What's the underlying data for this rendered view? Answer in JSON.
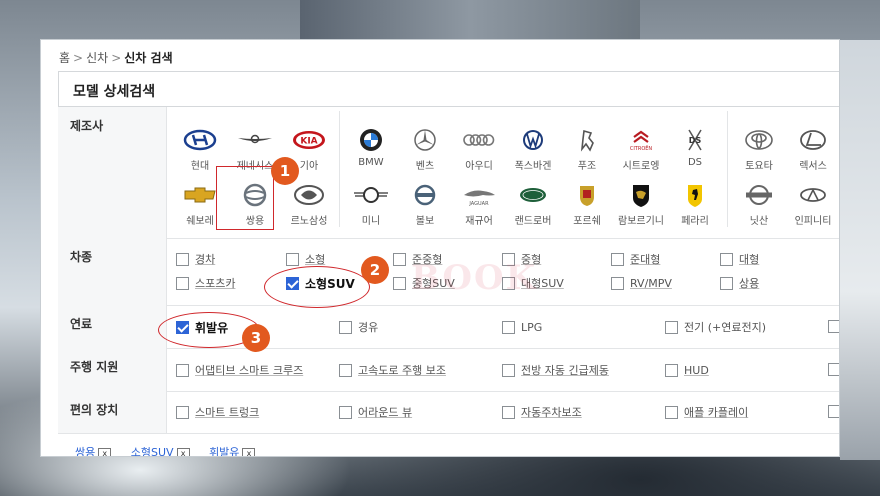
{
  "breadcrumb": {
    "home": "홈",
    "sep": ">",
    "level1": "신차",
    "current": "신차 검색"
  },
  "section_title": "모델 상세검색",
  "watermark": "BOOK",
  "manufacturer": {
    "label": "제조사",
    "domestic": [
      {
        "name": "현대",
        "icon": "hyundai-logo"
      },
      {
        "name": "제네시스",
        "icon": "genesis-logo"
      },
      {
        "name": "기아",
        "icon": "kia-logo"
      },
      {
        "name": "쉐보레",
        "icon": "chevrolet-logo"
      },
      {
        "name": "쌍용",
        "icon": "ssangyong-logo"
      },
      {
        "name": "르노삼성",
        "icon": "renault-samsung-logo"
      }
    ],
    "europe": [
      {
        "name": "BMW",
        "icon": "bmw-logo"
      },
      {
        "name": "벤츠",
        "icon": "benz-logo"
      },
      {
        "name": "아우디",
        "icon": "audi-logo"
      },
      {
        "name": "폭스바겐",
        "icon": "volkswagen-logo"
      },
      {
        "name": "푸조",
        "icon": "peugeot-logo"
      },
      {
        "name": "시트로엥",
        "icon": "citroen-logo"
      },
      {
        "name": "DS",
        "icon": "ds-logo"
      },
      {
        "name": "미니",
        "icon": "mini-logo"
      },
      {
        "name": "볼보",
        "icon": "volvo-logo"
      },
      {
        "name": "재규어",
        "icon": "jaguar-logo"
      },
      {
        "name": "랜드로버",
        "icon": "landrover-logo"
      },
      {
        "name": "포르쉐",
        "icon": "porsche-logo"
      },
      {
        "name": "람보르기니",
        "icon": "lamborghini-logo"
      },
      {
        "name": "페라리",
        "icon": "ferrari-logo"
      }
    ],
    "asia": [
      {
        "name": "토요타",
        "icon": "toyota-logo"
      },
      {
        "name": "렉서스",
        "icon": "lexus-logo"
      },
      {
        "name": "닛산",
        "icon": "nissan-logo"
      },
      {
        "name": "인피니티",
        "icon": "infiniti-logo"
      }
    ]
  },
  "body_type": {
    "label": "차종",
    "options": [
      {
        "label": "경차",
        "checked": false
      },
      {
        "label": "소형",
        "checked": false
      },
      {
        "label": "준중형",
        "checked": false
      },
      {
        "label": "중형",
        "checked": false
      },
      {
        "label": "준대형",
        "checked": false
      },
      {
        "label": "대형",
        "checked": false
      },
      {
        "label": "스포츠카",
        "checked": false
      },
      {
        "label": "소형SUV",
        "checked": true
      },
      {
        "label": "중형SUV",
        "checked": false
      },
      {
        "label": "대형SUV",
        "checked": false
      },
      {
        "label": "RV/MPV",
        "checked": false
      },
      {
        "label": "상용",
        "checked": false
      }
    ]
  },
  "fuel": {
    "label": "연료",
    "options": [
      {
        "label": "휘발유",
        "checked": true
      },
      {
        "label": "경유",
        "checked": false
      },
      {
        "label": "LPG",
        "checked": false
      },
      {
        "label": "전기 (+연료전지)",
        "checked": false
      }
    ]
  },
  "driving_assist": {
    "label": "주행 지원",
    "options": [
      {
        "label": "어댑티브 스마트 크루즈",
        "checked": false
      },
      {
        "label": "고속도로 주행 보조",
        "checked": false
      },
      {
        "label": "전방 자동 긴급제동",
        "checked": false
      },
      {
        "label": "HUD",
        "checked": false
      }
    ]
  },
  "convenience": {
    "label": "편의 장치",
    "options": [
      {
        "label": "스마트 트렁크",
        "checked": false
      },
      {
        "label": "어라운드 뷰",
        "checked": false
      },
      {
        "label": "자동주차보조",
        "checked": false
      },
      {
        "label": "애플 카플레이",
        "checked": false
      }
    ]
  },
  "selected_filters": [
    {
      "label": "쌍용",
      "remove": "x"
    },
    {
      "label": "소형SUV",
      "remove": "x"
    },
    {
      "label": "휘발유",
      "remove": "x"
    }
  ],
  "callouts": [
    "1",
    "2",
    "3"
  ],
  "colors": {
    "accent_check": "#2d64d6",
    "callout_fill": "#e2591f",
    "annotation_red": "#d0282c"
  }
}
